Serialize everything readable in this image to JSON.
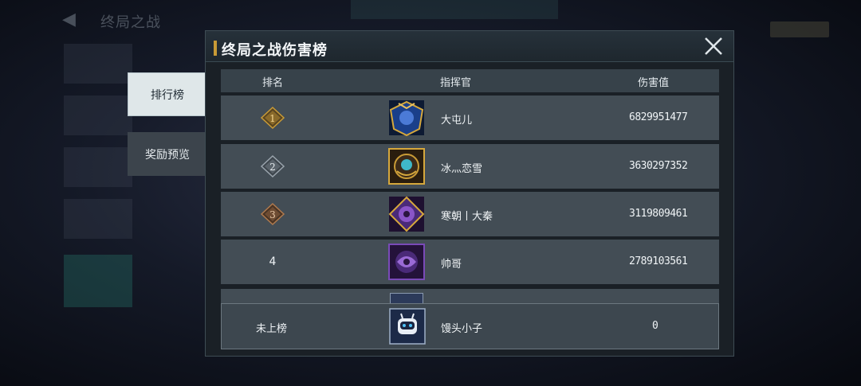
{
  "background": {
    "title": "终局之战"
  },
  "tabs": [
    {
      "label": "排行榜",
      "active": true
    },
    {
      "label": "奖励预览",
      "active": false
    }
  ],
  "panel": {
    "title": "终局之战伤害榜",
    "columns": [
      "排名",
      "指挥官",
      "伤害值"
    ],
    "rows": [
      {
        "rank": "1",
        "rank_style": "gold",
        "name": "大屯儿",
        "damage": "6829951477",
        "avatar_icon": "blue-gold-crest-icon"
      },
      {
        "rank": "2",
        "rank_style": "silver",
        "name": "冰灬恋雪",
        "damage": "3630297352",
        "avatar_icon": "teal-gold-crest-icon"
      },
      {
        "rank": "3",
        "rank_style": "bronze",
        "name": "寒朝丨大秦",
        "damage": "3119809461",
        "avatar_icon": "purple-gold-crest-icon"
      },
      {
        "rank": "4",
        "rank_style": "plain",
        "name": "帅哥",
        "damage": "2789103561",
        "avatar_icon": "purple-crest-icon"
      }
    ],
    "self_row": {
      "rank": "未上榜",
      "name": "馒头小子",
      "damage": "0",
      "avatar_icon": "robot-avatar-icon"
    }
  },
  "colors": {
    "gold": "#c99b36",
    "silver": "#9aa4ad",
    "bronze": "#b07a4e",
    "purple": "#6b3fa0"
  }
}
